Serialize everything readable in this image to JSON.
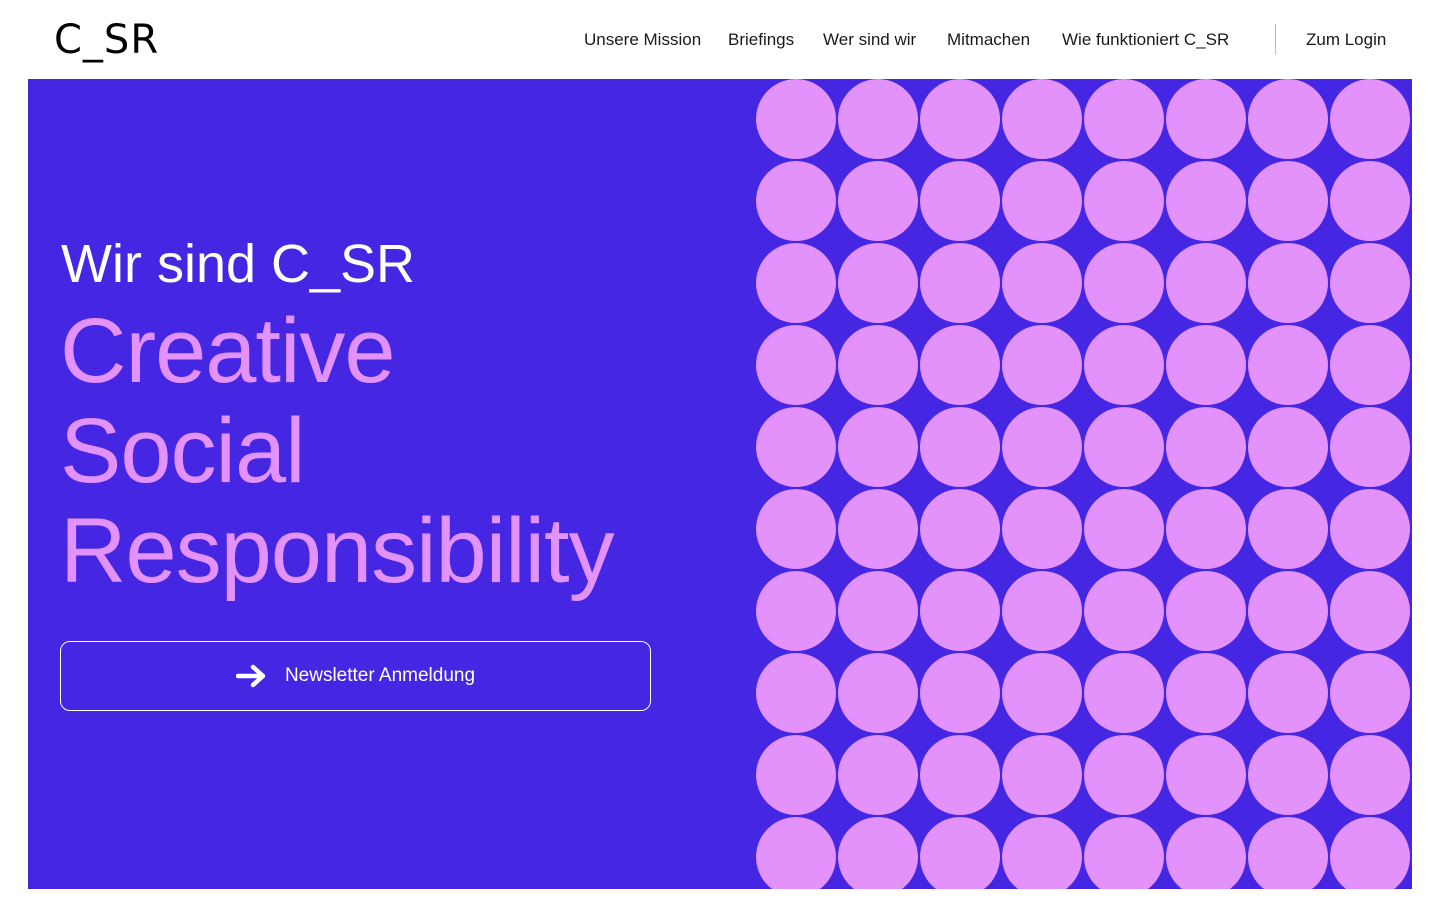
{
  "header": {
    "logo_text": "C_SR",
    "nav": [
      {
        "label": "Unsere Mission",
        "name": "nav-unsere-mission"
      },
      {
        "label": "Briefings",
        "name": "nav-briefings"
      },
      {
        "label": "Wer sind wir",
        "name": "nav-wer-sind-wir"
      },
      {
        "label": "Mitmachen",
        "name": "nav-mitmachen"
      },
      {
        "label": "Wie funktioniert C_SR",
        "name": "nav-wie-funktioniert"
      },
      {
        "label": "Zum Login",
        "name": "nav-zum-login"
      }
    ]
  },
  "hero": {
    "eyebrow": "Wir sind C_SR",
    "headline": [
      "Creative",
      "Social",
      "Responsibility"
    ],
    "cta_label": "Newsletter Anmeldung",
    "cta_icon": "arrow-right-icon"
  },
  "pattern": {
    "columns": 8,
    "rows": 10
  },
  "colors": {
    "hero_background": "#4426e3",
    "accent_pink": "#e391fb",
    "text_dark": "#1a1a1a",
    "white": "#ffffff"
  }
}
